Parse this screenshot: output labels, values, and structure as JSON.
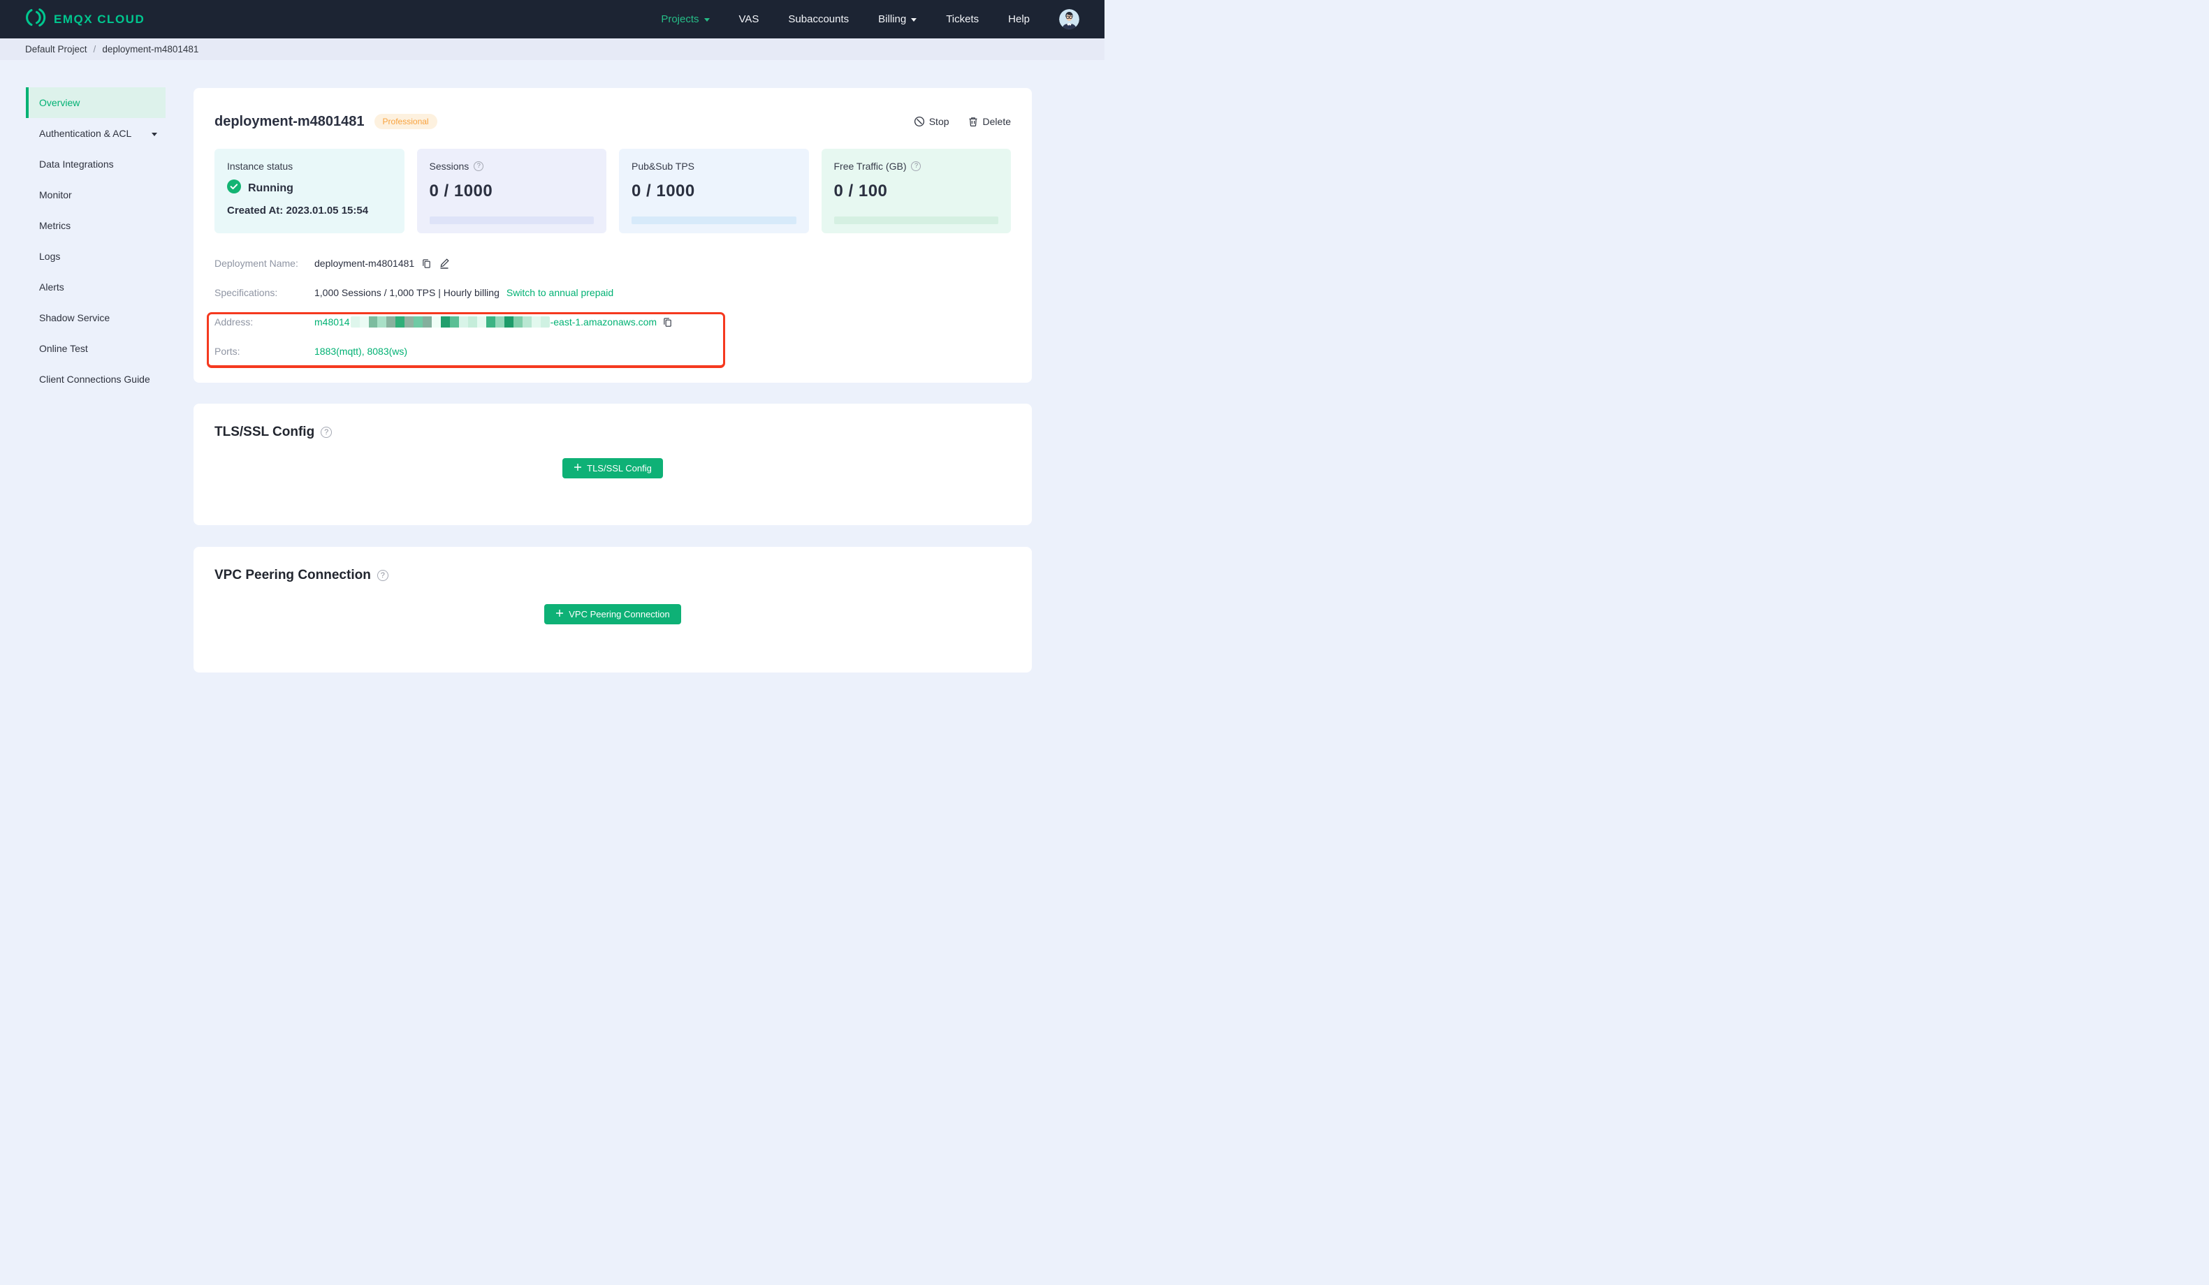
{
  "nav": {
    "logo_text": "EMQX CLOUD",
    "items": [
      {
        "label": "Projects",
        "active": true,
        "has_caret": true
      },
      {
        "label": "VAS"
      },
      {
        "label": "Subaccounts"
      },
      {
        "label": "Billing",
        "has_caret": true
      },
      {
        "label": "Tickets"
      },
      {
        "label": "Help"
      }
    ]
  },
  "breadcrumb": {
    "items": [
      "Default Project",
      "deployment-m4801481"
    ],
    "separator": "/"
  },
  "sidebar": {
    "items": [
      {
        "label": "Overview",
        "active": true
      },
      {
        "label": "Authentication & ACL",
        "has_caret": true
      },
      {
        "label": "Data Integrations"
      },
      {
        "label": "Monitor"
      },
      {
        "label": "Metrics"
      },
      {
        "label": "Logs"
      },
      {
        "label": "Alerts"
      },
      {
        "label": "Shadow Service"
      },
      {
        "label": "Online Test"
      },
      {
        "label": "Client Connections Guide"
      }
    ]
  },
  "deployment": {
    "title": "deployment-m4801481",
    "plan_badge": "Professional",
    "actions": {
      "stop": "Stop",
      "delete": "Delete"
    },
    "stats": [
      {
        "label": "Instance status",
        "status": "Running",
        "created_at": "Created At: 2023.01.05 15:54"
      },
      {
        "label": "Sessions",
        "value": "0 / 1000",
        "has_help": true
      },
      {
        "label": "Pub&Sub TPS",
        "value": "0 / 1000"
      },
      {
        "label": "Free Traffic (GB)",
        "value": "0 / 100",
        "has_help": true
      }
    ],
    "details": {
      "name_label": "Deployment Name:",
      "name_value": "deployment-m4801481",
      "spec_label": "Specifications:",
      "spec_value": "1,000 Sessions / 1,000 TPS | Hourly billing",
      "spec_link": "Switch to annual prepaid",
      "address_label": "Address:",
      "address_prefix": "m48014",
      "address_suffix": "-east-1.amazonaws.com",
      "address_redacted": true,
      "ports_label": "Ports:",
      "ports_value": "1883(mqtt), 8083(ws)"
    },
    "redaction_colors": [
      "#def6ec",
      "#ebfbf4",
      "#7cbc9f",
      "#a9e0c7",
      "#88b29e",
      "#30af79",
      "#8fb3a1",
      "#6fcaa4",
      "#84b09d",
      "#effdf6",
      "#219f6d",
      "#5abf95",
      "#d8f4e8",
      "#c5edda",
      "#e6faf1",
      "#3cb484",
      "#93d8ba",
      "#1d9c6a",
      "#7fceaa",
      "#b9e7d2",
      "#e2f8ee",
      "#cff1e2"
    ]
  },
  "sections": {
    "tls": {
      "title": "TLS/SSL Config",
      "button": "TLS/SSL Config"
    },
    "vpc": {
      "title": "VPC Peering Connection",
      "button": "VPC Peering Connection"
    }
  },
  "theme": {
    "accent_green": "#00b173",
    "button_green": "#0eb176",
    "navbar_bg": "#1c2433",
    "badge_orange": "#f8a23e",
    "annotation_red": "#f5391f",
    "status_ok_green": "#13b473"
  }
}
